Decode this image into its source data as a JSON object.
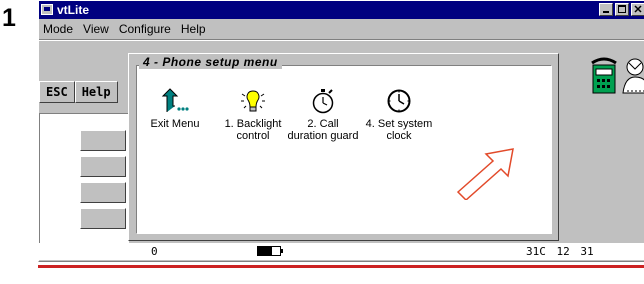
{
  "step_number": "1",
  "window": {
    "title": "vtLite",
    "menu": [
      "Mode",
      "View",
      "Configure",
      "Help"
    ]
  },
  "toolbar": {
    "esc_label": "ESC",
    "help_label": "Help"
  },
  "dialog": {
    "title": "4 - Phone setup menu",
    "items": [
      {
        "line1": "Exit Menu",
        "line2": "",
        "icon": "exit-arrow-icon"
      },
      {
        "line1": "1. Backlight",
        "line2": "control",
        "icon": "lightbulb-icon"
      },
      {
        "line1": "2. Call",
        "line2": "duration guard",
        "icon": "stopwatch-icon"
      },
      {
        "line1": "4. Set system",
        "line2": "clock",
        "icon": "clock-icon"
      }
    ]
  },
  "status": {
    "left": "0",
    "right": "31C  12 31"
  },
  "colors": {
    "titlebar": "#000080",
    "accent_red": "#cc2222",
    "bulb_yellow": "#ffff00",
    "exit_icon_teal": "#008080",
    "phone_green": "#00a050"
  }
}
